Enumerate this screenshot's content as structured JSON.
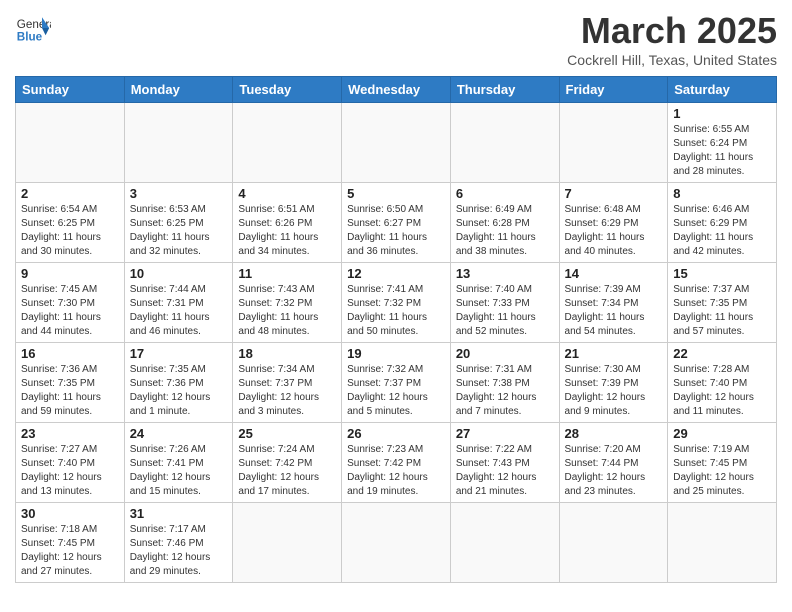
{
  "header": {
    "logo_general": "General",
    "logo_blue": "Blue",
    "title": "March 2025",
    "subtitle": "Cockrell Hill, Texas, United States"
  },
  "days_of_week": [
    "Sunday",
    "Monday",
    "Tuesday",
    "Wednesday",
    "Thursday",
    "Friday",
    "Saturday"
  ],
  "weeks": [
    [
      {
        "day": "",
        "info": ""
      },
      {
        "day": "",
        "info": ""
      },
      {
        "day": "",
        "info": ""
      },
      {
        "day": "",
        "info": ""
      },
      {
        "day": "",
        "info": ""
      },
      {
        "day": "",
        "info": ""
      },
      {
        "day": "1",
        "info": "Sunrise: 6:55 AM\nSunset: 6:24 PM\nDaylight: 11 hours\nand 28 minutes."
      }
    ],
    [
      {
        "day": "2",
        "info": "Sunrise: 6:54 AM\nSunset: 6:25 PM\nDaylight: 11 hours\nand 30 minutes."
      },
      {
        "day": "3",
        "info": "Sunrise: 6:53 AM\nSunset: 6:25 PM\nDaylight: 11 hours\nand 32 minutes."
      },
      {
        "day": "4",
        "info": "Sunrise: 6:51 AM\nSunset: 6:26 PM\nDaylight: 11 hours\nand 34 minutes."
      },
      {
        "day": "5",
        "info": "Sunrise: 6:50 AM\nSunset: 6:27 PM\nDaylight: 11 hours\nand 36 minutes."
      },
      {
        "day": "6",
        "info": "Sunrise: 6:49 AM\nSunset: 6:28 PM\nDaylight: 11 hours\nand 38 minutes."
      },
      {
        "day": "7",
        "info": "Sunrise: 6:48 AM\nSunset: 6:29 PM\nDaylight: 11 hours\nand 40 minutes."
      },
      {
        "day": "8",
        "info": "Sunrise: 6:46 AM\nSunset: 6:29 PM\nDaylight: 11 hours\nand 42 minutes."
      }
    ],
    [
      {
        "day": "9",
        "info": "Sunrise: 7:45 AM\nSunset: 7:30 PM\nDaylight: 11 hours\nand 44 minutes."
      },
      {
        "day": "10",
        "info": "Sunrise: 7:44 AM\nSunset: 7:31 PM\nDaylight: 11 hours\nand 46 minutes."
      },
      {
        "day": "11",
        "info": "Sunrise: 7:43 AM\nSunset: 7:32 PM\nDaylight: 11 hours\nand 48 minutes."
      },
      {
        "day": "12",
        "info": "Sunrise: 7:41 AM\nSunset: 7:32 PM\nDaylight: 11 hours\nand 50 minutes."
      },
      {
        "day": "13",
        "info": "Sunrise: 7:40 AM\nSunset: 7:33 PM\nDaylight: 11 hours\nand 52 minutes."
      },
      {
        "day": "14",
        "info": "Sunrise: 7:39 AM\nSunset: 7:34 PM\nDaylight: 11 hours\nand 54 minutes."
      },
      {
        "day": "15",
        "info": "Sunrise: 7:37 AM\nSunset: 7:35 PM\nDaylight: 11 hours\nand 57 minutes."
      }
    ],
    [
      {
        "day": "16",
        "info": "Sunrise: 7:36 AM\nSunset: 7:35 PM\nDaylight: 11 hours\nand 59 minutes."
      },
      {
        "day": "17",
        "info": "Sunrise: 7:35 AM\nSunset: 7:36 PM\nDaylight: 12 hours\nand 1 minute."
      },
      {
        "day": "18",
        "info": "Sunrise: 7:34 AM\nSunset: 7:37 PM\nDaylight: 12 hours\nand 3 minutes."
      },
      {
        "day": "19",
        "info": "Sunrise: 7:32 AM\nSunset: 7:37 PM\nDaylight: 12 hours\nand 5 minutes."
      },
      {
        "day": "20",
        "info": "Sunrise: 7:31 AM\nSunset: 7:38 PM\nDaylight: 12 hours\nand 7 minutes."
      },
      {
        "day": "21",
        "info": "Sunrise: 7:30 AM\nSunset: 7:39 PM\nDaylight: 12 hours\nand 9 minutes."
      },
      {
        "day": "22",
        "info": "Sunrise: 7:28 AM\nSunset: 7:40 PM\nDaylight: 12 hours\nand 11 minutes."
      }
    ],
    [
      {
        "day": "23",
        "info": "Sunrise: 7:27 AM\nSunset: 7:40 PM\nDaylight: 12 hours\nand 13 minutes."
      },
      {
        "day": "24",
        "info": "Sunrise: 7:26 AM\nSunset: 7:41 PM\nDaylight: 12 hours\nand 15 minutes."
      },
      {
        "day": "25",
        "info": "Sunrise: 7:24 AM\nSunset: 7:42 PM\nDaylight: 12 hours\nand 17 minutes."
      },
      {
        "day": "26",
        "info": "Sunrise: 7:23 AM\nSunset: 7:42 PM\nDaylight: 12 hours\nand 19 minutes."
      },
      {
        "day": "27",
        "info": "Sunrise: 7:22 AM\nSunset: 7:43 PM\nDaylight: 12 hours\nand 21 minutes."
      },
      {
        "day": "28",
        "info": "Sunrise: 7:20 AM\nSunset: 7:44 PM\nDaylight: 12 hours\nand 23 minutes."
      },
      {
        "day": "29",
        "info": "Sunrise: 7:19 AM\nSunset: 7:45 PM\nDaylight: 12 hours\nand 25 minutes."
      }
    ],
    [
      {
        "day": "30",
        "info": "Sunrise: 7:18 AM\nSunset: 7:45 PM\nDaylight: 12 hours\nand 27 minutes."
      },
      {
        "day": "31",
        "info": "Sunrise: 7:17 AM\nSunset: 7:46 PM\nDaylight: 12 hours\nand 29 minutes."
      },
      {
        "day": "",
        "info": ""
      },
      {
        "day": "",
        "info": ""
      },
      {
        "day": "",
        "info": ""
      },
      {
        "day": "",
        "info": ""
      },
      {
        "day": "",
        "info": ""
      }
    ]
  ]
}
